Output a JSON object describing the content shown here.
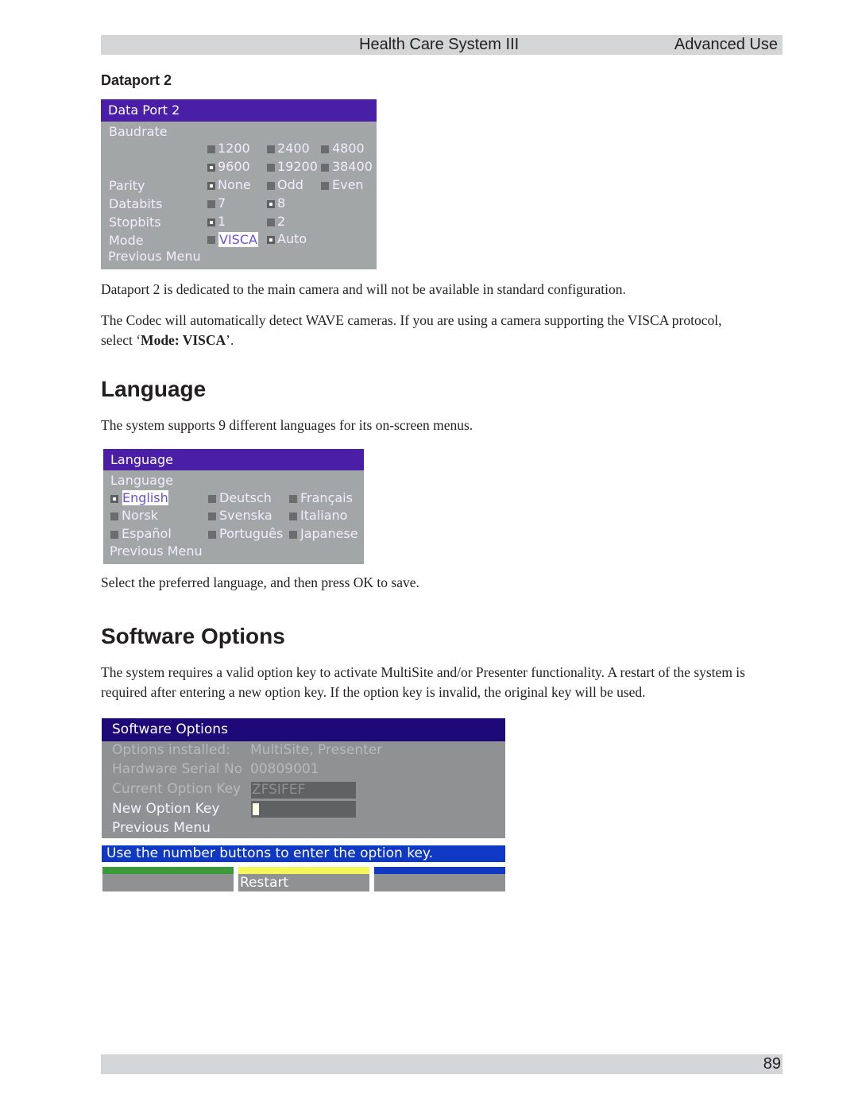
{
  "header": {
    "title": "Health Care System III",
    "section": "Advanced Use"
  },
  "dataport": {
    "subheading": "Dataport 2",
    "menu": {
      "title": "Data Port 2",
      "baudrate_label": "Baudrate",
      "baud_options": [
        {
          "label": "1200",
          "selected": false
        },
        {
          "label": "2400",
          "selected": false
        },
        {
          "label": "4800",
          "selected": false
        },
        {
          "label": "9600",
          "selected": true
        },
        {
          "label": "19200",
          "selected": false
        },
        {
          "label": "38400",
          "selected": false
        }
      ],
      "parity_label": "Parity",
      "parity_options": [
        {
          "label": "None",
          "selected": true
        },
        {
          "label": "Odd",
          "selected": false
        },
        {
          "label": "Even",
          "selected": false
        }
      ],
      "databits_label": "Databits",
      "databits_options": [
        {
          "label": "7",
          "selected": false
        },
        {
          "label": "8",
          "selected": true
        }
      ],
      "stopbits_label": "Stopbits",
      "stopbits_options": [
        {
          "label": "1",
          "selected": true
        },
        {
          "label": "2",
          "selected": false
        }
      ],
      "mode_label": "Mode",
      "mode_options": [
        {
          "label": "VISCA",
          "selected": false,
          "highlighted": true
        },
        {
          "label": "Auto",
          "selected": true
        }
      ],
      "previous_menu": "Previous Menu"
    },
    "para1": "Dataport 2 is dedicated to the main camera and will not be available in standard configuration.",
    "para2_a": "The Codec will automatically detect WAVE cameras. If you are using a camera supporting the VISCA protocol, select ‘",
    "para2_bold": "Mode: VISCA",
    "para2_b": "’."
  },
  "language": {
    "heading": "Language",
    "intro": "The system supports 9 different languages for its on-screen menus.",
    "menu": {
      "title": "Language",
      "label": "Language",
      "options": [
        {
          "label": "English",
          "selected": true,
          "highlighted": true
        },
        {
          "label": "Deutsch",
          "selected": false
        },
        {
          "label": "Français",
          "selected": false
        },
        {
          "label": "Norsk",
          "selected": false
        },
        {
          "label": "Svenska",
          "selected": false
        },
        {
          "label": "Italiano",
          "selected": false
        },
        {
          "label": "Español",
          "selected": false
        },
        {
          "label": "Português",
          "selected": false
        },
        {
          "label": "Japanese",
          "selected": false
        }
      ],
      "previous_menu": "Previous Menu"
    },
    "after": "Select the preferred language, and then press OK to save."
  },
  "software": {
    "heading": "Software Options",
    "intro": "The system requires a valid option key to activate MultiSite and/or Presenter functionality. A restart of the system is required after entering a new option key. If the option key is invalid, the original key will be used.",
    "menu": {
      "title": "Software Options",
      "options_installed_label": "Options installed:",
      "options_installed_value": "MultiSite, Presenter",
      "serial_label": "Hardware Serial No",
      "serial_value": "00809001",
      "current_key_label": "Current Option Key",
      "current_key_value": "ZFSIFEF",
      "new_key_label": "New Option Key",
      "new_key_value": "",
      "previous_menu": "Previous Menu",
      "message": "Use the number buttons to enter the option key.",
      "function_buttons": [
        {
          "label": "",
          "color": "#3a9a3a"
        },
        {
          "label": "Restart",
          "color": "#f6f65a"
        },
        {
          "label": "",
          "color": "#0f38c4"
        }
      ]
    }
  },
  "footer": {
    "page_number": "89"
  }
}
